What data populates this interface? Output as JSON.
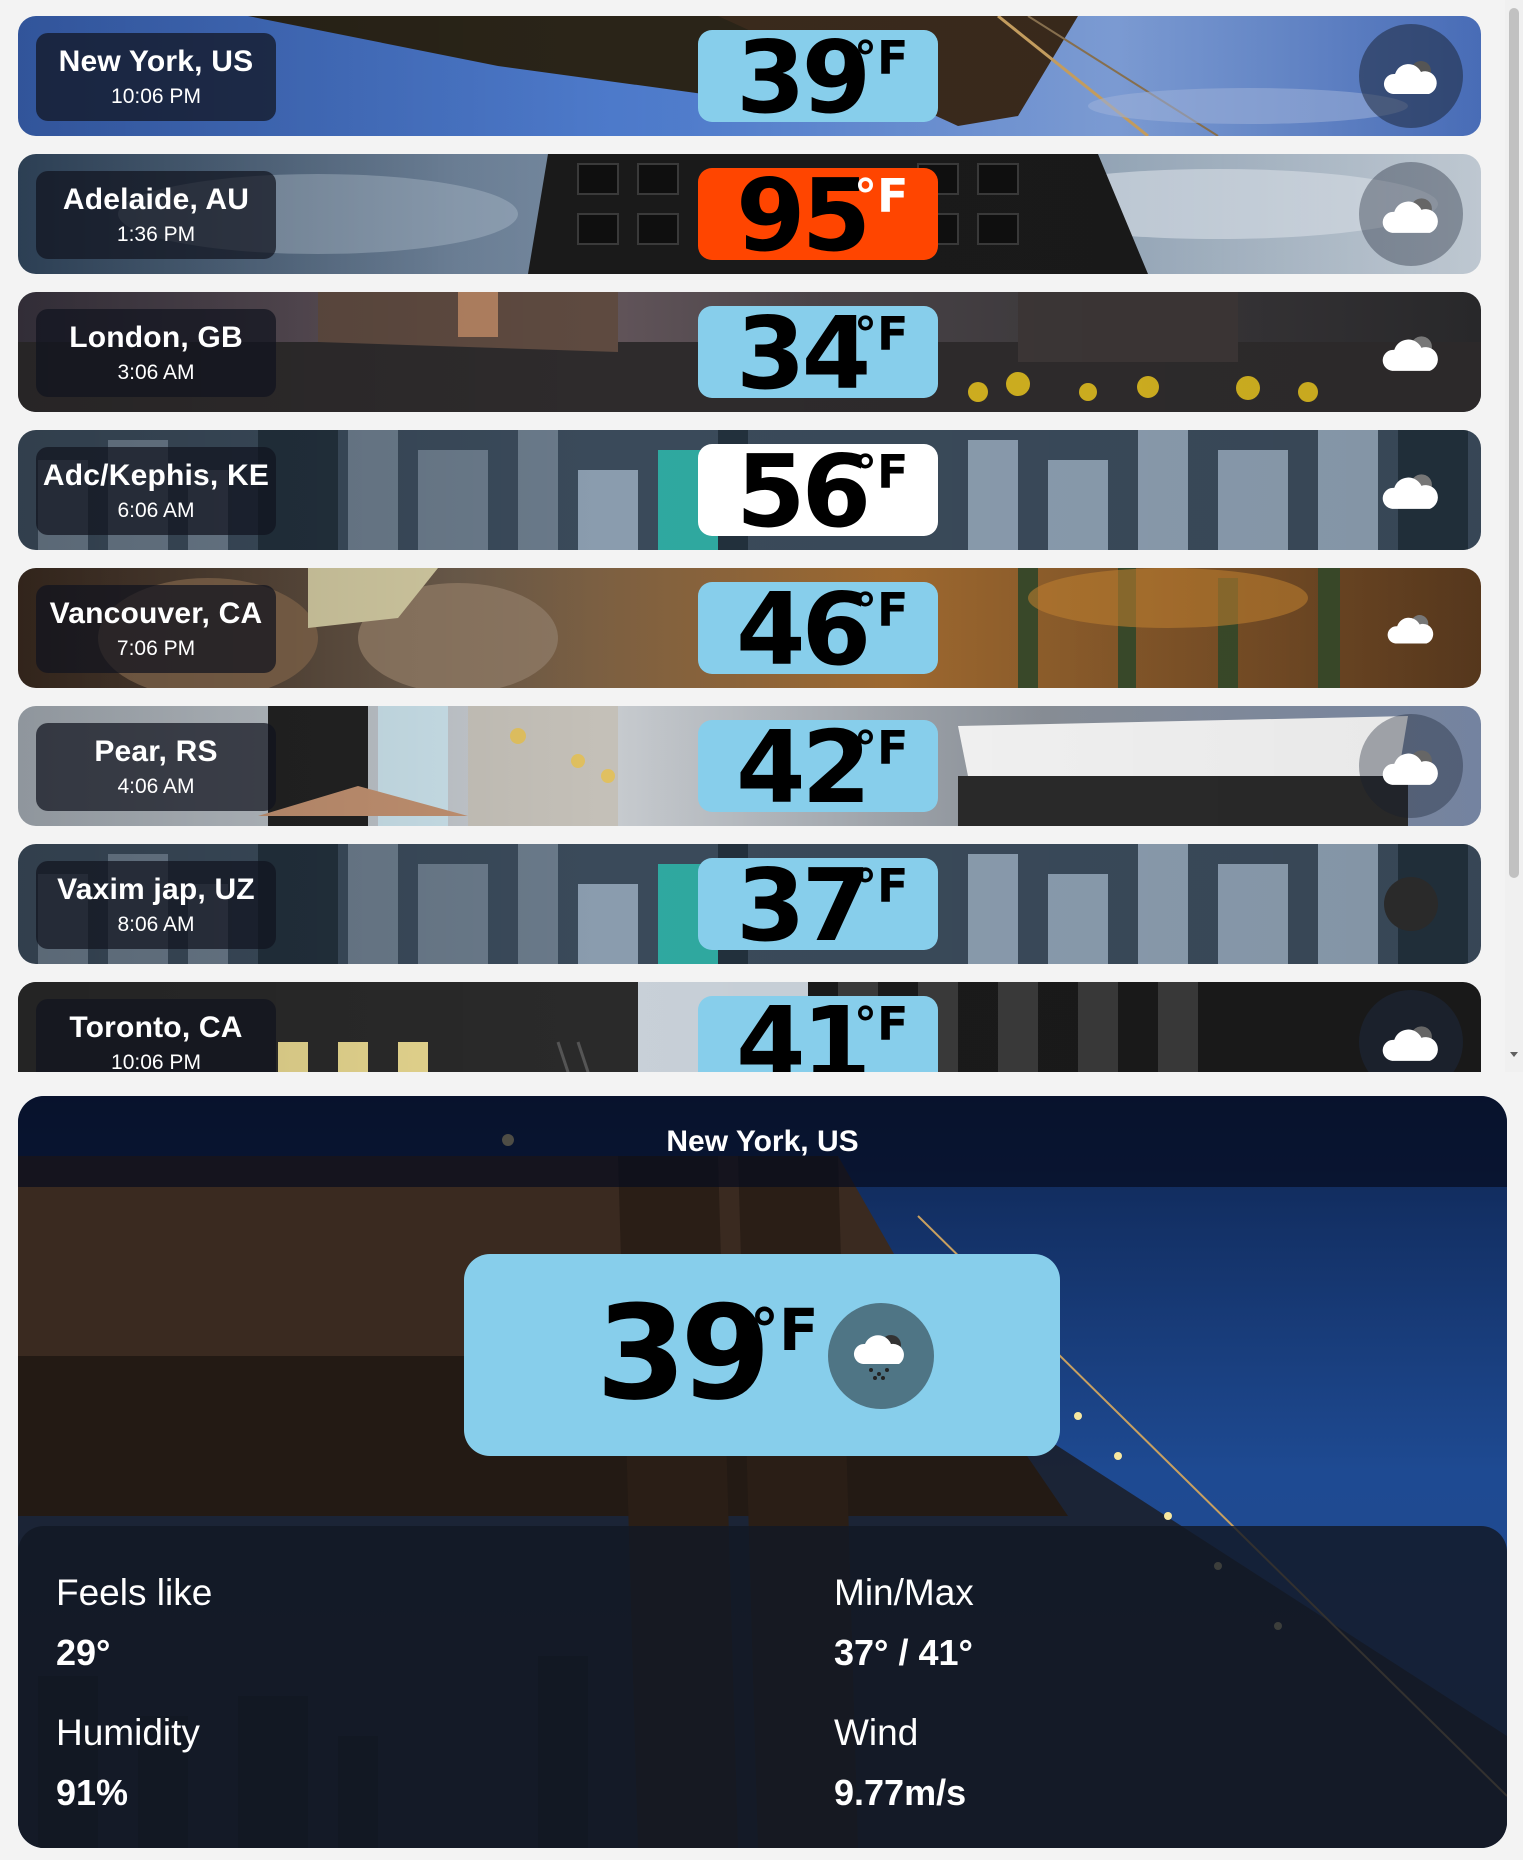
{
  "cities": [
    {
      "name": "New York, US",
      "time": "10:06 PM",
      "temp": "39",
      "unit": "°F",
      "temp_bg": "#87ceeb",
      "icon": "cloud-icon"
    },
    {
      "name": "Adelaide, AU",
      "time": "1:36 PM",
      "temp": "95",
      "unit": "°F",
      "temp_bg": "#ff4500",
      "icon": "cloud-icon"
    },
    {
      "name": "London, GB",
      "time": "3:06 AM",
      "temp": "34",
      "unit": "°F",
      "temp_bg": "#87ceeb",
      "icon": "cloud-icon"
    },
    {
      "name": "Adc/Kephis, KE",
      "time": "6:06 AM",
      "temp": "56",
      "unit": "°F",
      "temp_bg": "#ffffff",
      "icon": "cloud-icon"
    },
    {
      "name": "Vancouver, CA",
      "time": "7:06 PM",
      "temp": "46",
      "unit": "°F",
      "temp_bg": "#87ceeb",
      "icon": "cloud-icon"
    },
    {
      "name": "Pear, RS",
      "time": "4:06 AM",
      "temp": "42",
      "unit": "°F",
      "temp_bg": "#87ceeb",
      "icon": "cloud-icon"
    },
    {
      "name": "Vaxim jap, UZ",
      "time": "8:06 AM",
      "temp": "37",
      "unit": "°F",
      "temp_bg": "#87ceeb",
      "icon": "moon-icon"
    },
    {
      "name": "Toronto, CA",
      "time": "10:06 PM",
      "temp": "41",
      "unit": "°F",
      "temp_bg": "#87ceeb",
      "icon": "cloud-icon"
    }
  ],
  "detail": {
    "city": "New York, US",
    "temp": "39",
    "unit": "°F",
    "icon": "rain-cloud-icon",
    "feels_like_label": "Feels like",
    "feels_like": "29°",
    "minmax_label": "Min/Max",
    "minmax": "37° / 41°",
    "humidity_label": "Humidity",
    "humidity": "91%",
    "wind_label": "Wind",
    "wind": "9.77m/s"
  }
}
